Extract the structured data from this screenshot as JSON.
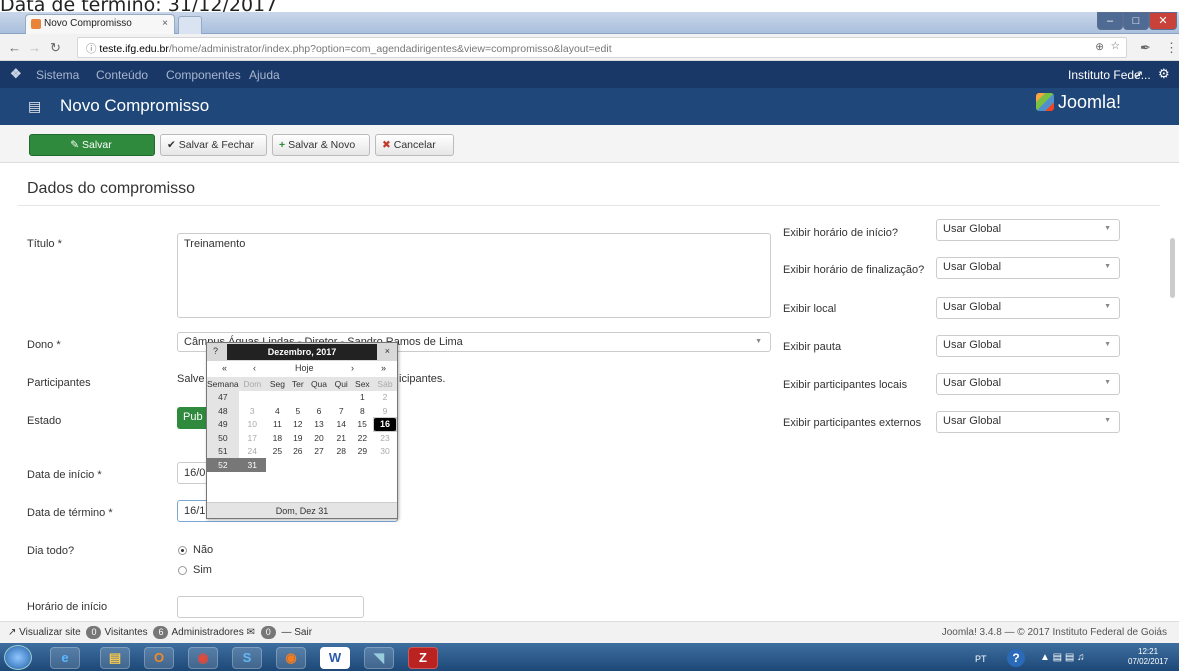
{
  "caption": "Data de término: 31/12/2017",
  "browser": {
    "tab_title": "Novo Compromisso",
    "tab_close": "×",
    "url_host": "teste.ifg.edu.br",
    "url_path": "/home/administrator/index.php?option=com_agendadirigentes&view=compromisso&layout=edit"
  },
  "joomla_menu": {
    "items": [
      "Sistema",
      "Conteúdo",
      "Componentes",
      "Ajuda"
    ],
    "site_link": "Instituto Fede...",
    "logo": "Joomla!"
  },
  "page": {
    "title": "Novo Compromisso"
  },
  "toolbar": {
    "save": "Salvar",
    "save_close": "Salvar & Fechar",
    "save_new": "Salvar & Novo",
    "cancel": "Cancelar"
  },
  "form": {
    "section_title": "Dados do compromisso",
    "titulo_label": "Título *",
    "titulo_value": "Treinamento",
    "dono_label": "Dono *",
    "dono_value": "Câmpus Águas Lindas - Diretor - Sandro Ramos de Lima",
    "participantes_label": "Participantes",
    "participantes_text_a": "Salve",
    "participantes_text_b": "icipantes.",
    "estado_label": "Estado",
    "estado_value": "Pub",
    "data_inicio_label": "Data de início *",
    "data_inicio_value": "16/0",
    "data_termino_label": "Data de término *",
    "data_termino_value": "16/1",
    "dia_todo_label": "Dia todo?",
    "dia_todo_nao": "Não",
    "dia_todo_sim": "Sim",
    "horario_inicio_label": "Horário de início"
  },
  "options": {
    "items": [
      {
        "label": "Exibir horário de início?",
        "value": "Usar Global"
      },
      {
        "label": "Exibir horário de finalização?",
        "value": "Usar Global"
      },
      {
        "label": "Exibir local",
        "value": "Usar Global"
      },
      {
        "label": "Exibir pauta",
        "value": "Usar Global"
      },
      {
        "label": "Exibir participantes locais",
        "value": "Usar Global"
      },
      {
        "label": "Exibir participantes externos",
        "value": "Usar Global"
      }
    ]
  },
  "calendar": {
    "help": "?",
    "month": "Dezembro, 2017",
    "close": "×",
    "prev_year": "«",
    "prev_month": "‹",
    "today": "Hoje",
    "next_month": "›",
    "next_year": "»",
    "day_headers": [
      "Semana",
      "Dom",
      "Seg",
      "Ter",
      "Qua",
      "Qui",
      "Sex",
      "Sáb"
    ],
    "weeks": [
      [
        "47",
        "",
        "",
        "",
        "",
        "",
        "1",
        "2"
      ],
      [
        "48",
        "3",
        "4",
        "5",
        "6",
        "7",
        "8",
        "9"
      ],
      [
        "49",
        "10",
        "11",
        "12",
        "13",
        "14",
        "15",
        "16"
      ],
      [
        "50",
        "17",
        "18",
        "19",
        "20",
        "21",
        "22",
        "23"
      ],
      [
        "51",
        "24",
        "25",
        "26",
        "27",
        "28",
        "29",
        "30"
      ],
      [
        "52",
        "31",
        "",
        "",
        "",
        "",
        "",
        ""
      ]
    ],
    "selected_day": "16",
    "hover_day": "31",
    "footer": "Dom, Dez 31"
  },
  "statusbar": {
    "view_site": "Visualizar site",
    "visitors_count": "0",
    "visitors": "Visitantes",
    "admins_count": "6",
    "admins": "Administradores",
    "messages_count": "0",
    "logout": "Sair",
    "version": "Joomla! 3.4.8 — © 2017 Instituto Federal de Goiás"
  },
  "taskbar": {
    "lang": "PT",
    "time": "12:21",
    "date": "07/02/2017"
  },
  "colors": {
    "joomla_topbar": "#1a3867",
    "joomla_titlebar": "#1f4779",
    "save_green": "#2f8a3d"
  }
}
